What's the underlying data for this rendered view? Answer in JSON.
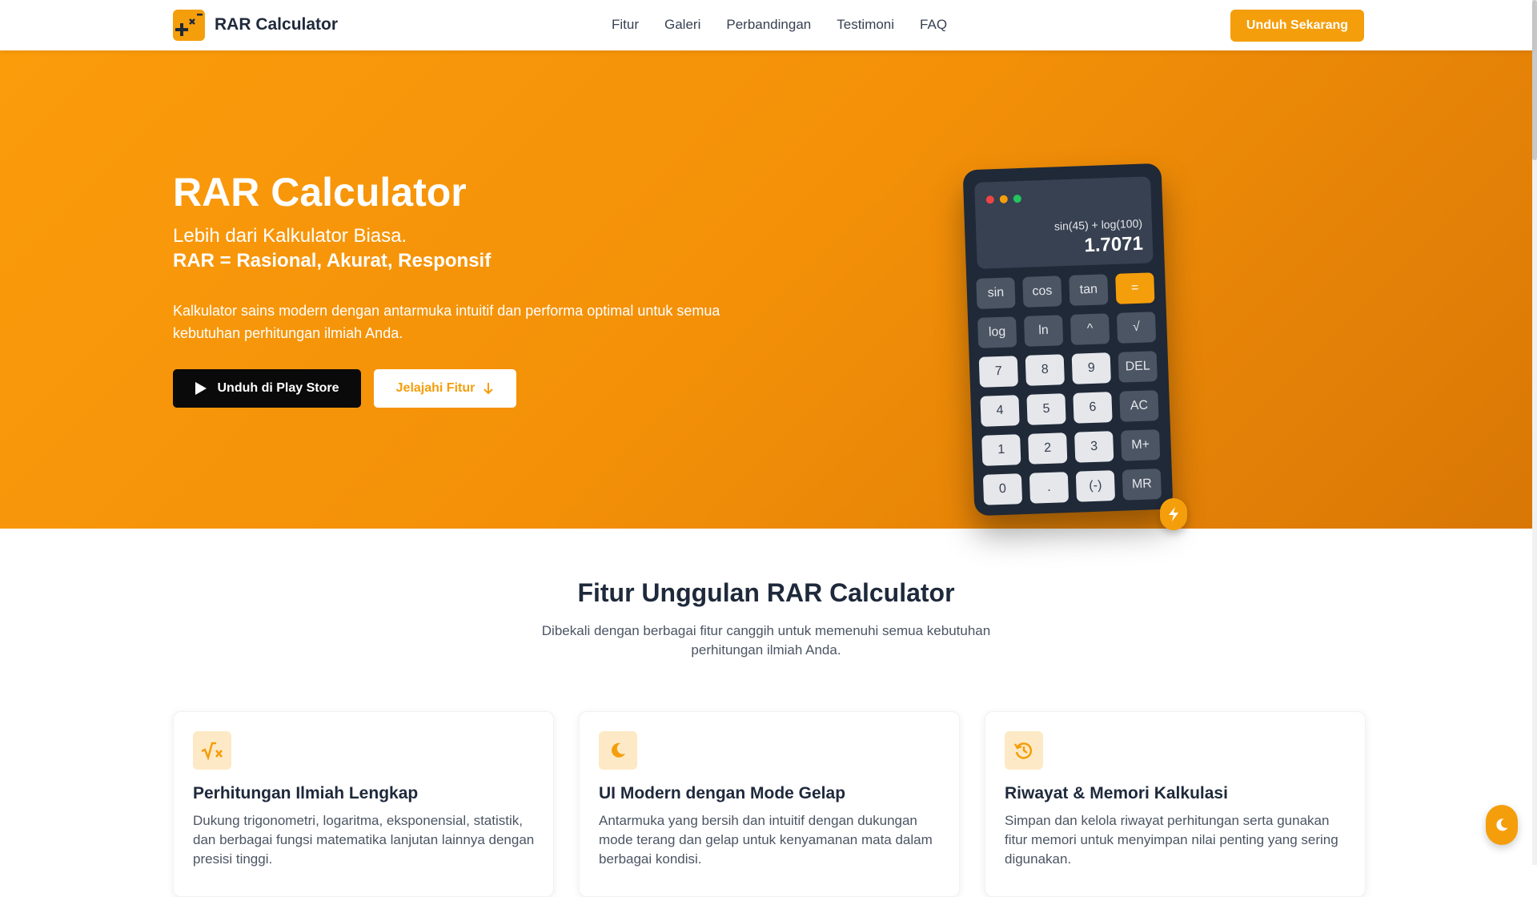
{
  "nav": {
    "brand": "RAR Calculator",
    "logo_icon": "calculator-symbols-icon",
    "links": [
      "Fitur",
      "Galeri",
      "Perbandingan",
      "Testimoni",
      "FAQ"
    ],
    "cta": "Unduh Sekarang"
  },
  "hero": {
    "title": "RAR Calculator",
    "subtitle": "Lebih dari Kalkulator Biasa.",
    "tagline": "RAR = Rasional, Akurat, Responsif",
    "description": "Kalkulator sains modern dengan antarmuka intuitif dan performa optimal untuk semua kebutuhan perhitungan ilmiah Anda.",
    "btn_play": "Unduh di Play Store",
    "btn_play_icon": "play-store-icon",
    "btn_explore": "Jelajahi Fitur",
    "btn_explore_icon": "arrow-down-icon"
  },
  "calculator": {
    "expression": "sin(45) + log(100)",
    "result": "1.7071",
    "keys": [
      {
        "label": "sin",
        "kind": "fn"
      },
      {
        "label": "cos",
        "kind": "fn"
      },
      {
        "label": "tan",
        "kind": "fn"
      },
      {
        "label": "=",
        "kind": "eq"
      },
      {
        "label": "log",
        "kind": "fn"
      },
      {
        "label": "ln",
        "kind": "fn"
      },
      {
        "label": "^",
        "kind": "fn"
      },
      {
        "label": "√",
        "kind": "fn"
      },
      {
        "label": "7",
        "kind": "num"
      },
      {
        "label": "8",
        "kind": "num"
      },
      {
        "label": "9",
        "kind": "num"
      },
      {
        "label": "DEL",
        "kind": "fn"
      },
      {
        "label": "4",
        "kind": "num"
      },
      {
        "label": "5",
        "kind": "num"
      },
      {
        "label": "6",
        "kind": "num"
      },
      {
        "label": "AC",
        "kind": "fn"
      },
      {
        "label": "1",
        "kind": "num"
      },
      {
        "label": "2",
        "kind": "num"
      },
      {
        "label": "3",
        "kind": "num"
      },
      {
        "label": "M+",
        "kind": "fn"
      },
      {
        "label": "0",
        "kind": "num"
      },
      {
        "label": ".",
        "kind": "num"
      },
      {
        "label": "(-)",
        "kind": "num"
      },
      {
        "label": "MR",
        "kind": "fn"
      }
    ],
    "badge_icon": "bolt-icon"
  },
  "features": {
    "title": "Fitur Unggulan RAR Calculator",
    "description": "Dibekali dengan berbagai fitur canggih untuk memenuhi semua kebutuhan perhitungan ilmiah Anda.",
    "cards": [
      {
        "icon": "square-root-icon",
        "title": "Perhitungan Ilmiah Lengkap",
        "desc": "Dukung trigonometri, logaritma, eksponensial, statistik, dan berbagai fungsi matematika lanjutan lainnya dengan presisi tinggi."
      },
      {
        "icon": "moon-icon",
        "title": "UI Modern dengan Mode Gelap",
        "desc": "Antarmuka yang bersih dan intuitif dengan dukungan mode terang dan gelap untuk kenyamanan mata dalam berbagai kondisi."
      },
      {
        "icon": "history-icon",
        "title": "Riwayat & Memori Kalkulasi",
        "desc": "Simpan dan kelola riwayat perhitungan serta gunakan fitur memori untuk menyimpan nilai penting yang sering digunakan."
      }
    ]
  },
  "theme_toggle_icon": "moon-icon",
  "colors": {
    "accent": "#f59e0b",
    "dark": "#1f2937",
    "text": "#1e293b"
  }
}
